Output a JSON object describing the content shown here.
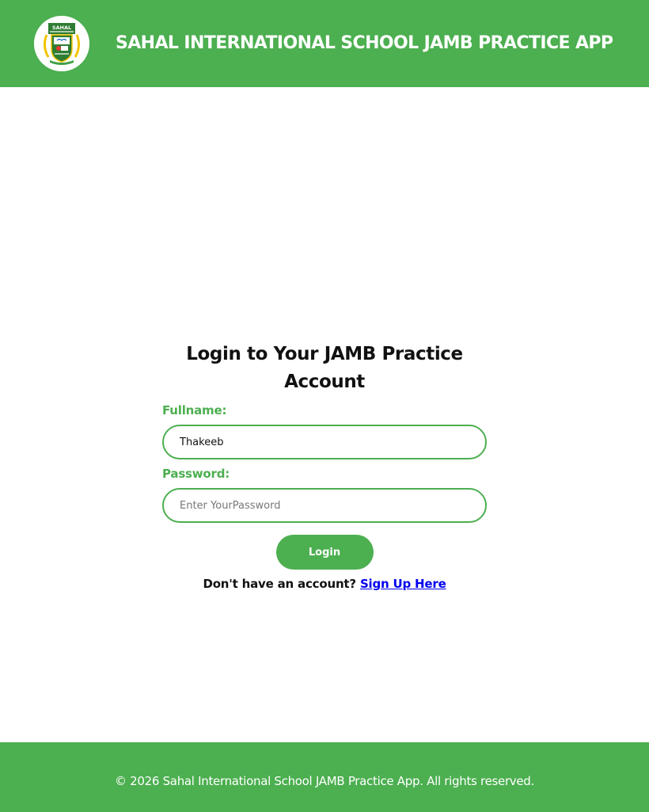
{
  "colors": {
    "brand_green": "#4caf50",
    "link_blue": "#0000ee",
    "text_dark": "#111111"
  },
  "header": {
    "logo_text": "SAHAL",
    "title": "SAHAL INTERNATIONAL SCHOOL JAMB PRACTICE APP"
  },
  "login": {
    "heading": "Login to Your JAMB Practice Account",
    "fullname_label": "Fullname:",
    "fullname_value": "Thakeeb",
    "password_label": "Password:",
    "password_placeholder": "Enter YourPassword",
    "login_button": "Login",
    "signup_prompt": "Don't have an account?",
    "signup_link": "Sign Up Here"
  },
  "footer": {
    "copyright": "© 2026 Sahal International School JAMB Practice App. All rights reserved."
  }
}
